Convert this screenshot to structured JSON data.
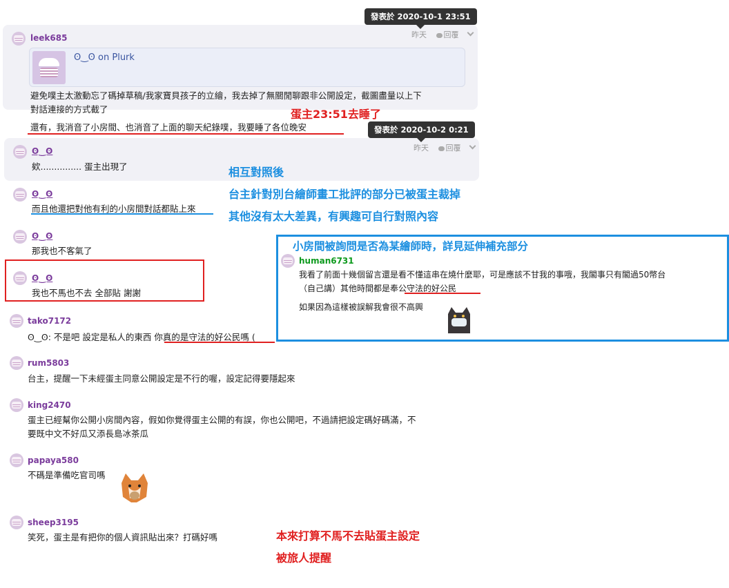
{
  "tooltips": {
    "first": "發表於 2020-10-1 23:51",
    "second": "發表於 2020-10-2 0:21"
  },
  "meta": {
    "time": "昨天",
    "reply": "回覆"
  },
  "posts": [
    {
      "user": "leek685",
      "embed_title": "ʘ‿ʘ on Plurk",
      "text1": "避免噗主太激動忘了碼掉草稿/我家寶貝孩子的立繪，我去掉了無關閒聊跟非公開設定，截圖盡量以上下",
      "text2": "對話連接的方式截了",
      "text3": "還有，我消音了小房間、也消音了上面的聊天紀錄噗，我要睡了各位晚安"
    },
    {
      "user": "ʘ‿ʘ",
      "text": "欸............... 蛋主出現了"
    },
    {
      "user": "ʘ‿ʘ",
      "text": "而且他還把對他有利的小房間對話都貼上來"
    },
    {
      "user": "ʘ‿ʘ",
      "text": "那我也不客氣了"
    },
    {
      "user": "ʘ‿ʘ",
      "text": "我也不馬也不去 全部貼 謝謝"
    },
    {
      "user": "tako7172",
      "text_a": "ʘ‿ʘ: 不是吧 設定是私人的東西 ",
      "text_b": "你真的是守法的好公民嗎 ("
    },
    {
      "user": "rum5803",
      "text": "台主，提醒一下未經蛋主同意公開設定是不行的喔，設定記得要隱起來"
    },
    {
      "user": "king2470",
      "text1": "蛋主已經幫你公開小房間內容，假如你覺得蛋主公開的有誤，你也公開吧，不過請把設定碼好碼滿，不",
      "text2": "要既中文不好瓜又添長島冰茶瓜"
    },
    {
      "user": "papaya580",
      "text": "不碼是準備吃官司嗎"
    },
    {
      "user": "sheep3195",
      "text": "笑死，蛋主是有把你的個人資訊貼出來？打碼好嗎"
    }
  ],
  "inset": {
    "title": "小房間被詢問是否為某繪師時，詳見延伸補充部分",
    "user": "human6731",
    "text1": "我看了前面十幾個留言還是看不懂這串在燒什麼耶，可是應該不甘我的事哦，我閣事只有閣過50幣台",
    "text2a": "（自己講）其他時間都是",
    "text2b": "奉公守法的好公民",
    "text3": "如果因為這樣被誤解我會很不高興"
  },
  "annotations": {
    "sleep": "蛋主23:51去睡了",
    "compare1": "相互對照後",
    "compare2": "台主針對別台繪師畫工批評的部分已被蛋主裁掉",
    "compare3": "其他沒有太大差異，有興趣可自行對照內容",
    "bottom1": "本來打算不馬不去貼蛋主設定",
    "bottom2": "被旅人提醒"
  },
  "colors": {
    "red": "#e02020",
    "blue": "#1c8fe0",
    "username": "#7b3c9c",
    "card": "#f1f1f6"
  }
}
